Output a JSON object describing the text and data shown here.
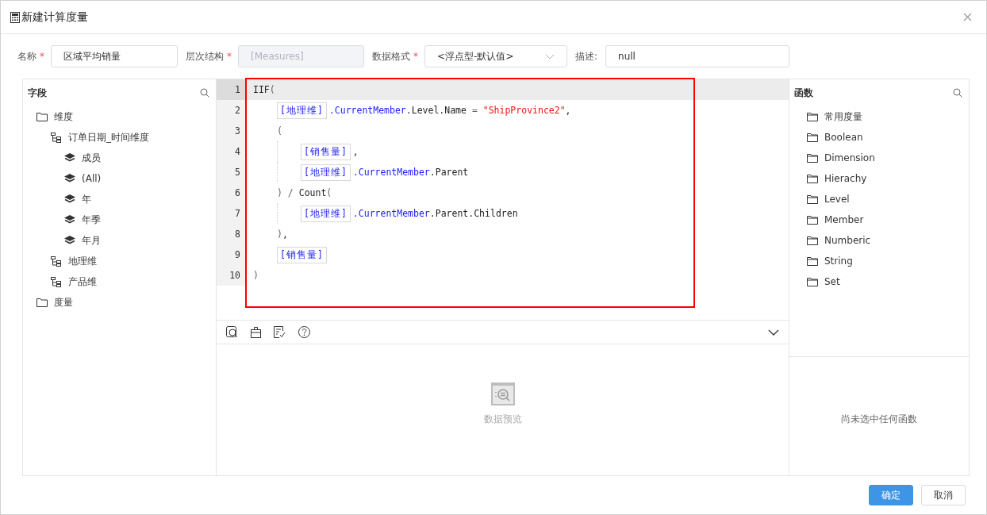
{
  "window": {
    "title": "新建计算度量"
  },
  "form": [
    {
      "label": "名称",
      "required_mark": "*",
      "value": "区域平均销量",
      "kind": "input"
    },
    {
      "label": "层次结构",
      "required_mark": "*",
      "value": "[Measures]",
      "disabled": true,
      "kind": "input"
    },
    {
      "label": "数据格式",
      "required_mark": "*",
      "value": "<浮点型-默认值>",
      "kind": "select"
    },
    {
      "label": "描述:",
      "value": "null",
      "kind": "input"
    }
  ],
  "fields": {
    "title": "字段",
    "tree": [
      {
        "kind": "folder",
        "label": "维度",
        "children": [
          {
            "kind": "hierarchy",
            "label": "订单日期_时间维度",
            "children": [
              {
                "kind": "level",
                "label": "成员"
              },
              {
                "kind": "level",
                "label": "(All)"
              },
              {
                "kind": "level",
                "label": "年"
              },
              {
                "kind": "level",
                "label": "年季"
              },
              {
                "kind": "level",
                "label": "年月"
              }
            ]
          },
          {
            "kind": "hierarchy",
            "label": "地理维"
          },
          {
            "kind": "hierarchy",
            "label": "产品维"
          }
        ]
      },
      {
        "kind": "folder",
        "label": "度量"
      }
    ]
  },
  "editor": {
    "annotation_frame": true,
    "lines": [
      {
        "number": "1",
        "active": true,
        "tokens": [
          {
            "kind": "text",
            "text": "IIF"
          },
          {
            "kind": "punct",
            "text": "("
          }
        ],
        "children": [
          {
            "number": "2",
            "active": false,
            "tokens": [
              {
                "kind": "member",
                "text": "[地理维]"
              },
              {
                "kind": "prop",
                "text": ".CurrentMember"
              },
              {
                "kind": "text",
                "text": ".Level.Name"
              },
              {
                "kind": "punct",
                "text": " = "
              },
              {
                "kind": "string",
                "text": "\"ShipProvince2\""
              },
              {
                "kind": "text",
                "text": ","
              }
            ]
          },
          {
            "number": "3",
            "active": false,
            "tokens": [
              {
                "kind": "punct",
                "text": "("
              }
            ],
            "children": [
              {
                "number": "4",
                "active": false,
                "tokens": [
                  {
                    "kind": "member",
                    "text": "[销售量]"
                  },
                  {
                    "kind": "text",
                    "text": ","
                  }
                ]
              },
              {
                "number": "5",
                "active": false,
                "tokens": [
                  {
                    "kind": "member",
                    "text": "[地理维]"
                  },
                  {
                    "kind": "prop",
                    "text": ".CurrentMember"
                  },
                  {
                    "kind": "text",
                    "text": ".Parent"
                  }
                ]
              }
            ]
          },
          {
            "number": "6",
            "active": false,
            "tokens": [
              {
                "kind": "punct",
                "text": ") / "
              },
              {
                "kind": "text",
                "text": "Count"
              },
              {
                "kind": "punct",
                "text": "("
              }
            ],
            "children": [
              {
                "number": "7",
                "active": false,
                "tokens": [
                  {
                    "kind": "member",
                    "text": "[地理维]"
                  },
                  {
                    "kind": "prop",
                    "text": ".CurrentMember"
                  },
                  {
                    "kind": "text",
                    "text": ".Parent.Children"
                  }
                ]
              }
            ]
          },
          {
            "number": "8",
            "active": false,
            "tokens": [
              {
                "kind": "punct",
                "text": ")"
              },
              {
                "kind": "text",
                "text": ","
              }
            ]
          },
          {
            "number": "9",
            "active": false,
            "tokens": [
              {
                "kind": "member",
                "text": "[销售量]"
              }
            ]
          }
        ]
      },
      {
        "number": "10",
        "active": false,
        "tokens": [
          {
            "kind": "punct",
            "text": ")"
          }
        ]
      }
    ]
  },
  "preview": {
    "empty_text": "数据预览"
  },
  "functions": {
    "title": "函数",
    "items": [
      "常用度量",
      "Boolean",
      "Dimension",
      "Hierachy",
      "Level",
      "Member",
      "Numberic",
      "String",
      "Set"
    ],
    "empty_text": "尚未选中任何函数"
  },
  "buttons": [
    {
      "label": "确定",
      "kind": "primary"
    },
    {
      "label": "取消",
      "kind": "default"
    }
  ]
}
